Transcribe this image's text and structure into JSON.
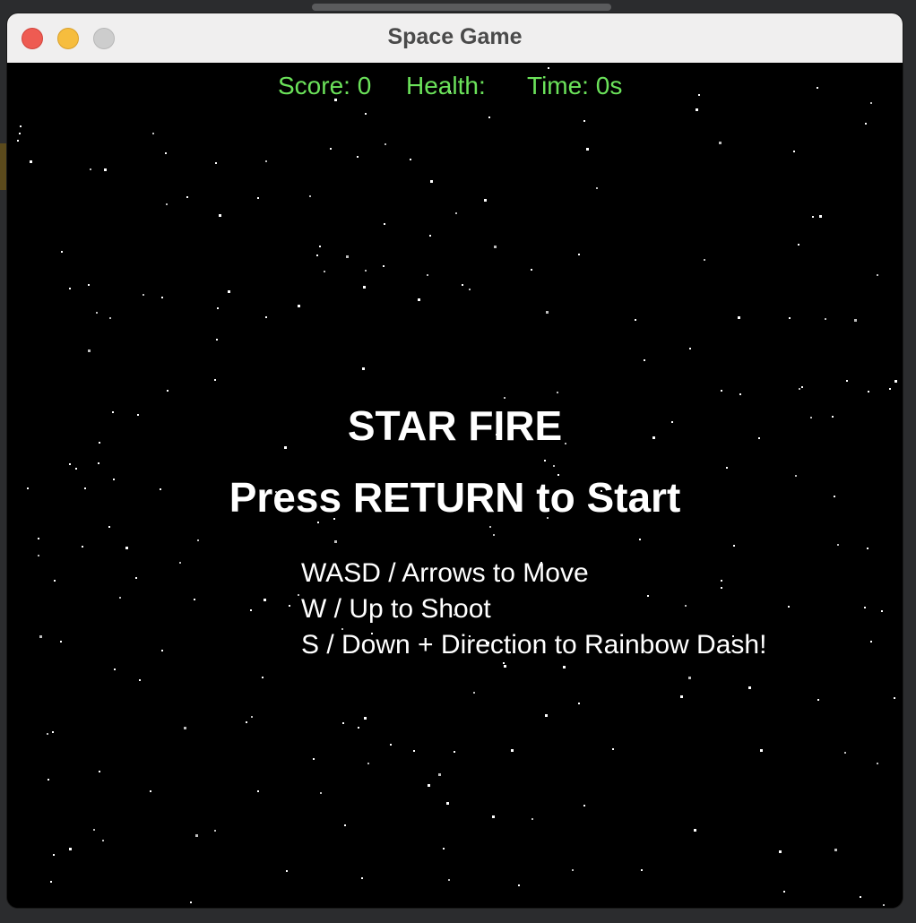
{
  "window": {
    "title": "Space Game"
  },
  "hud": {
    "score_label": "Score: 0",
    "health_label": "Health:",
    "time_label": "Time: 0s"
  },
  "title_screen": {
    "game_title": "STAR FIRE",
    "start_prompt": "Press RETURN to Start",
    "instructions": [
      "WASD / Arrows to Move",
      "W / Up to Shoot",
      "S / Down + Direction to Rainbow Dash!"
    ]
  },
  "colors": {
    "hud_text": "#6be25a",
    "background": "#000000",
    "text": "#ffffff",
    "close": "#ee5b52",
    "minimize": "#f6bd3e",
    "maximize": "#cdcdcd"
  }
}
